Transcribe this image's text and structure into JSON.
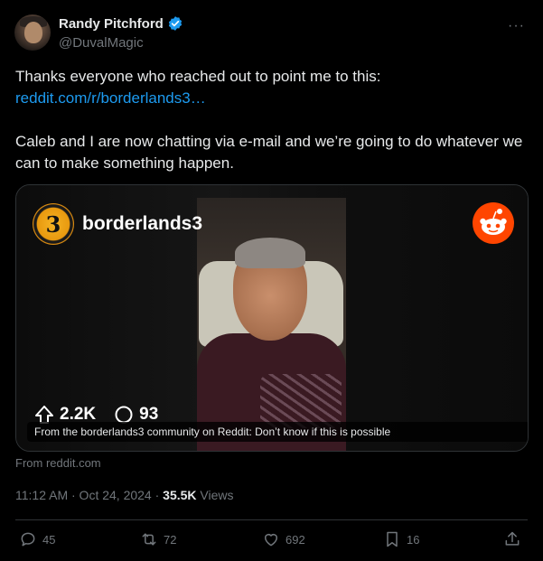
{
  "author": {
    "display_name": "Randy Pitchford",
    "handle": "@DuvalMagic",
    "verified": true
  },
  "menu": {
    "more_label": "···"
  },
  "tweet": {
    "line1": "Thanks everyone who reached out to point me to this:",
    "link": "reddit.com/r/borderlands3…",
    "line2": "Caleb and I are now chatting via e-mail and we’re going to do whatever we can to make something happen."
  },
  "card": {
    "subreddit_name": "borderlands3",
    "logo_glyph": "3",
    "upvotes": "2.2K",
    "comments": "93",
    "caption": "From the borderlands3 community on Reddit: Don’t know if this is possible"
  },
  "source": {
    "text": "From reddit.com"
  },
  "meta": {
    "time": "11:12 AM · Oct 24, 2024 · ",
    "views_count": "35.5K",
    "views_label": " Views"
  },
  "actions": {
    "replies": "45",
    "retweets": "72",
    "likes": "692",
    "bookmarks": "16"
  },
  "colors": {
    "link": "#1d9bf0",
    "muted": "#71767b",
    "text": "#e7e9ea",
    "reddit_orange": "#ff4500"
  }
}
